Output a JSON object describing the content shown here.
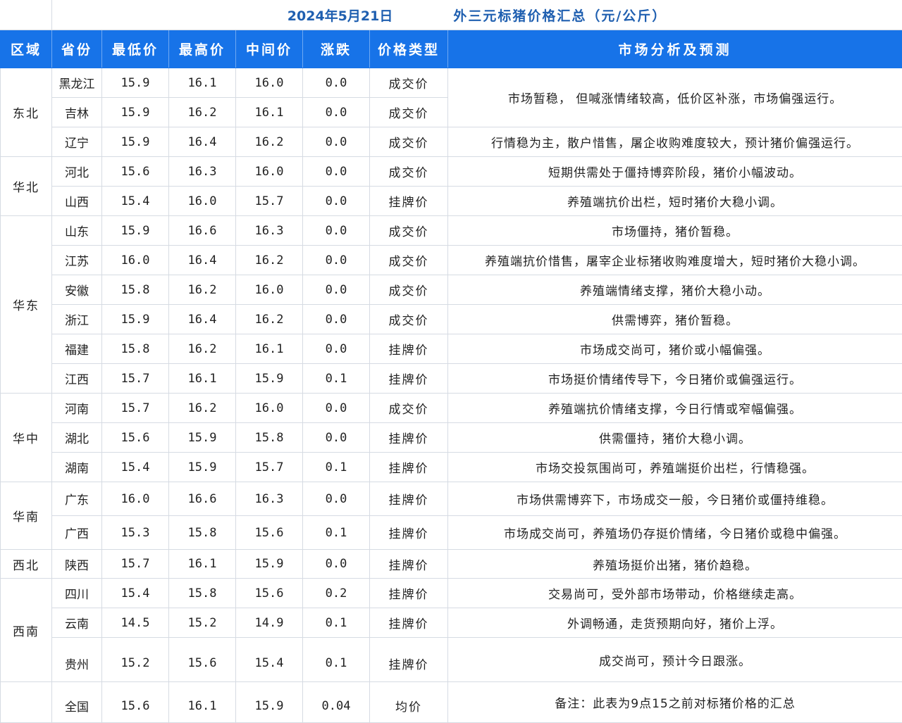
{
  "title": {
    "date": "2024年5月21日",
    "heading": "外三元标猪价格汇总（元/公斤）"
  },
  "headers": [
    "区域",
    "省份",
    "最低价",
    "最高价",
    "中间价",
    "涨跌",
    "价格类型",
    "市场分析及预测"
  ],
  "regions": {
    "dongbei": "东北",
    "huabei": "华北",
    "huadong": "华东",
    "huazhong": "华中",
    "huanan": "华南",
    "xibei": "西北",
    "xinan": "西南"
  },
  "rows": [
    {
      "province": "黑龙江",
      "low": "15.9",
      "high": "16.1",
      "mid": "16.0",
      "change": "0.0",
      "type": "成交价"
    },
    {
      "province": "吉林",
      "low": "15.9",
      "high": "16.2",
      "mid": "16.1",
      "change": "0.0",
      "type": "成交价"
    },
    {
      "province": "辽宁",
      "low": "15.9",
      "high": "16.4",
      "mid": "16.2",
      "change": "0.0",
      "type": "成交价"
    },
    {
      "province": "河北",
      "low": "15.6",
      "high": "16.3",
      "mid": "16.0",
      "change": "0.0",
      "type": "成交价"
    },
    {
      "province": "山西",
      "low": "15.4",
      "high": "16.0",
      "mid": "15.7",
      "change": "0.0",
      "type": "挂牌价"
    },
    {
      "province": "山东",
      "low": "15.9",
      "high": "16.6",
      "mid": "16.3",
      "change": "0.0",
      "type": "成交价"
    },
    {
      "province": "江苏",
      "low": "16.0",
      "high": "16.4",
      "mid": "16.2",
      "change": "0.0",
      "type": "成交价"
    },
    {
      "province": "安徽",
      "low": "15.8",
      "high": "16.2",
      "mid": "16.0",
      "change": "0.0",
      "type": "成交价"
    },
    {
      "province": "浙江",
      "low": "15.9",
      "high": "16.4",
      "mid": "16.2",
      "change": "0.0",
      "type": "成交价"
    },
    {
      "province": "福建",
      "low": "15.8",
      "high": "16.2",
      "mid": "16.1",
      "change": "0.0",
      "type": "挂牌价"
    },
    {
      "province": "江西",
      "low": "15.7",
      "high": "16.1",
      "mid": "15.9",
      "change": "0.1",
      "type": "挂牌价"
    },
    {
      "province": "河南",
      "low": "15.7",
      "high": "16.2",
      "mid": "16.0",
      "change": "0.0",
      "type": "成交价"
    },
    {
      "province": "湖北",
      "low": "15.6",
      "high": "15.9",
      "mid": "15.8",
      "change": "0.0",
      "type": "挂牌价"
    },
    {
      "province": "湖南",
      "low": "15.4",
      "high": "15.9",
      "mid": "15.7",
      "change": "0.1",
      "type": "挂牌价"
    },
    {
      "province": "广东",
      "low": "16.0",
      "high": "16.6",
      "mid": "16.3",
      "change": "0.0",
      "type": "挂牌价"
    },
    {
      "province": "广西",
      "low": "15.3",
      "high": "15.8",
      "mid": "15.6",
      "change": "0.1",
      "type": "挂牌价"
    },
    {
      "province": "陕西",
      "low": "15.7",
      "high": "16.1",
      "mid": "15.9",
      "change": "0.0",
      "type": "挂牌价"
    },
    {
      "province": "四川",
      "low": "15.4",
      "high": "15.8",
      "mid": "15.6",
      "change": "0.2",
      "type": "挂牌价"
    },
    {
      "province": "云南",
      "low": "14.5",
      "high": "15.2",
      "mid": "14.9",
      "change": "0.1",
      "type": "挂牌价"
    },
    {
      "province": "贵州",
      "low": "15.2",
      "high": "15.6",
      "mid": "15.4",
      "change": "0.1",
      "type": "挂牌价"
    }
  ],
  "national": {
    "province": "全国",
    "low": "15.6",
    "high": "16.1",
    "mid": "15.9",
    "change": "0.04",
    "type": "均价"
  },
  "analysis": {
    "dongbei_merged": "市场暂稳， 但喊涨情绪较高，低价区补涨，市场偏强运行。",
    "liaoning": "行情稳为主，散户惜售，屠企收购难度较大，预计猪价偏强运行。",
    "hebei": "短期供需处于僵持博弈阶段，猪价小幅波动。",
    "shanxi": "养殖端抗价出栏，短时猪价大稳小调。",
    "shandong": "市场僵持，猪价暂稳。",
    "jiangsu": "养殖端抗价惜售，屠宰企业标猪收购难度增大，短时猪价大稳小调。",
    "anhui": "养殖端情绪支撑，猪价大稳小动。",
    "zhejiang": "供需博弈，猪价暂稳。",
    "fujian": "市场成交尚可，猪价或小幅偏强。",
    "jiangxi": "市场挺价情绪传导下，今日猪价或偏强运行。",
    "henan": "养殖端抗价情绪支撑，今日行情或窄幅偏强。",
    "hubei": "供需僵持，猪价大稳小调。",
    "hunan": "市场交投氛围尚可，养殖端挺价出栏，行情稳强。",
    "guangdong": "市场供需博弈下，市场成交一般，今日猪价或僵持维稳。",
    "guangxi": "市场成交尚可，养殖场仍存挺价情绪，今日猪价或稳中偏强。",
    "shaanxi": "养殖场挺价出猪，猪价趋稳。",
    "sichuan": "交易尚可，受外部市场带动，价格继续走高。",
    "yunnan": "外调畅通，走货预期向好，猪价上浮。",
    "guizhou": "成交尚可，预计今日跟涨。",
    "national_note": "备注：此表为9点15之前对标猪价格的汇总"
  }
}
